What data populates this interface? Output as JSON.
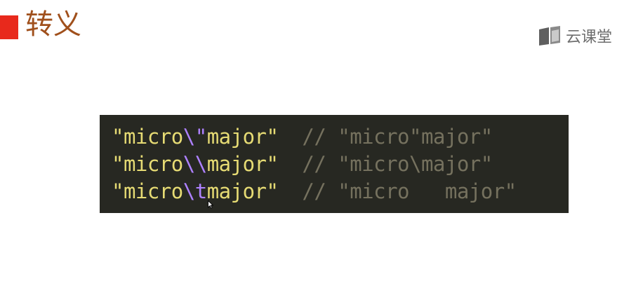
{
  "slide": {
    "title": "转义",
    "brand": "云课堂",
    "accent_color": "#e8291c",
    "title_color": "#a0501c"
  },
  "code": {
    "background": "#272822",
    "lines": [
      {
        "pre": "\"micro",
        "esc": "\\\"",
        "post": "major\"",
        "gap": "  ",
        "comment": "// \"micro\"major\""
      },
      {
        "pre": "\"micro",
        "esc": "\\\\",
        "post": "major\"",
        "gap": "  ",
        "comment": "// \"micro\\major\""
      },
      {
        "pre": "\"micro",
        "esc": "\\t",
        "post": "major\"",
        "gap": "  ",
        "comment": "// \"micro   major\""
      }
    ]
  },
  "icons": {
    "logo": "book-icon",
    "pointer": "mouse-cursor-icon"
  }
}
